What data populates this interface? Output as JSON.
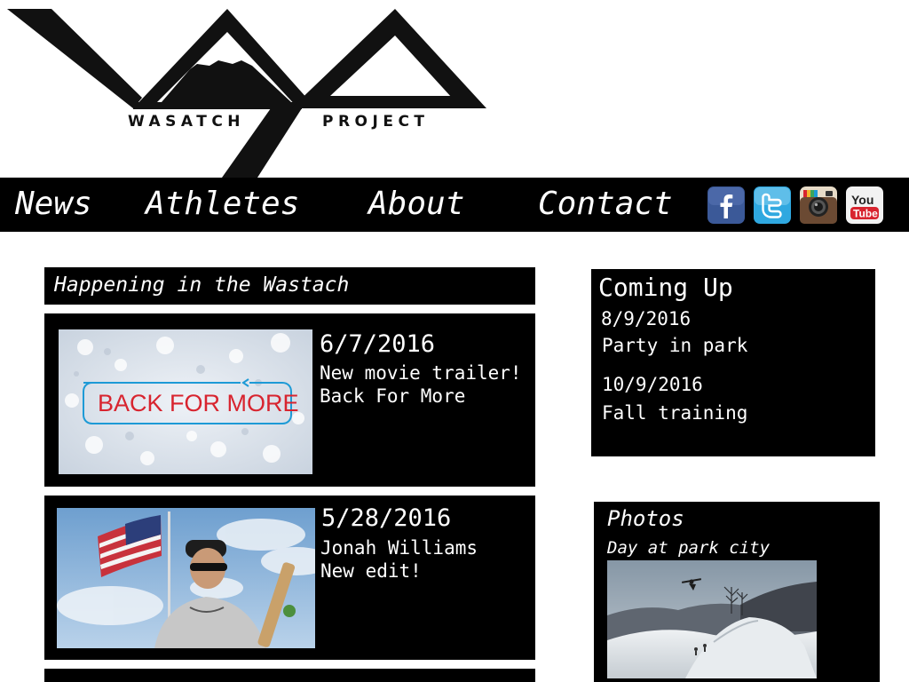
{
  "brand": {
    "left_word": "WASATCH",
    "right_word": "PROJECT"
  },
  "nav": {
    "items": [
      "News",
      "Athletes",
      "About",
      "Contact"
    ]
  },
  "social": [
    "facebook-icon",
    "twitter-icon",
    "instagram-icon",
    "youtube-icon"
  ],
  "news": {
    "heading": "Happening in the Wastach",
    "posts": [
      {
        "date": "6/7/2016",
        "line1": "New movie trailer!",
        "line2": "Back For More",
        "thumb_text": "BACK FOR MORE"
      },
      {
        "date": "5/28/2016",
        "line1": "Jonah Williams",
        "line2": "New edit!"
      }
    ]
  },
  "coming_up": {
    "title": "Coming Up",
    "events": [
      {
        "date": "8/9/2016",
        "name": "Party in park"
      },
      {
        "date": "10/9/2016",
        "name": "Fall training"
      }
    ]
  },
  "photos": {
    "title": "Photos",
    "caption": "Day at park city"
  },
  "colors": {
    "background": "#ffffff",
    "panel": "#000000",
    "text": "#ffffff",
    "accent_red": "#d8242f",
    "accent_blue": "#1d9ad6"
  }
}
